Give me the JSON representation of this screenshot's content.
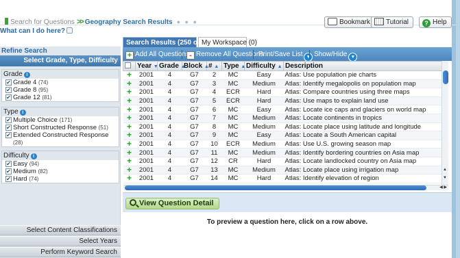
{
  "breadcrumb": {
    "link": "Search for Questions",
    "separator": ">>",
    "current": "Geography Search Results",
    "dots": "● ● ●"
  },
  "what_can": "What can I do here?",
  "header_buttons": {
    "bookmark": "Bookmark",
    "tutorial": "Tutorial",
    "help": "Help"
  },
  "refine": {
    "title": "Refine Search",
    "subtitle": "Select Grade, Type, Difficulty",
    "groups": [
      {
        "label": "Grade",
        "options": [
          {
            "label": "Grade 4",
            "count": "(74)",
            "checked": "✔"
          },
          {
            "label": "Grade 8",
            "count": "(95)",
            "checked": "✔"
          },
          {
            "label": "Grade 12",
            "count": "(81)",
            "checked": "✔"
          }
        ]
      },
      {
        "label": "Type",
        "options": [
          {
            "label": "Multiple Choice",
            "count": "(171)",
            "checked": "✔"
          },
          {
            "label": "Short Constructed Response",
            "count": "(51)",
            "checked": "✔"
          },
          {
            "label": "Extended Constructed Response",
            "count": "(28)",
            "checked": "✔"
          }
        ]
      },
      {
        "label": "Difficulty",
        "options": [
          {
            "label": "Easy",
            "count": "(94)",
            "checked": "✔"
          },
          {
            "label": "Medium",
            "count": "(82)",
            "checked": "✔"
          },
          {
            "label": "Hard",
            "count": "(74)",
            "checked": "✔"
          }
        ]
      }
    ],
    "bottom_buttons": [
      "Select Content Classifications",
      "Select Years",
      "Perform Keyword Search"
    ]
  },
  "tabs": {
    "results": "Search Results (250 of 250)",
    "workspace": "My Workspace (0)"
  },
  "toolbar": {
    "add_all": "Add All Questions",
    "remove_all": "Remove All Questions",
    "print_save": "Print/Save List",
    "show_hide": "Show/Hide"
  },
  "table": {
    "headers": [
      "Year",
      "Grade",
      "Block",
      "#",
      "Type",
      "Difficulty",
      "Description"
    ],
    "rows": [
      [
        "2001",
        "4",
        "G7",
        "2",
        "MC",
        "Easy",
        "Atlas: Use population pie charts"
      ],
      [
        "2001",
        "4",
        "G7",
        "3",
        "MC",
        "Medium",
        "Atlas: Identify megalopolis on population map"
      ],
      [
        "2001",
        "4",
        "G7",
        "4",
        "ECR",
        "Hard",
        "Atlas: Compare countries using three maps"
      ],
      [
        "2001",
        "4",
        "G7",
        "5",
        "ECR",
        "Hard",
        "Atlas: Use maps to explain land use"
      ],
      [
        "2001",
        "4",
        "G7",
        "6",
        "MC",
        "Easy",
        "Atlas: Locate ice caps and glaciers on world map"
      ],
      [
        "2001",
        "4",
        "G7",
        "7",
        "MC",
        "Medium",
        "Atlas: Locate continents in tropics"
      ],
      [
        "2001",
        "4",
        "G7",
        "8",
        "MC",
        "Medium",
        "Atlas: Locate place using latitude and longitude"
      ],
      [
        "2001",
        "4",
        "G7",
        "9",
        "MC",
        "Easy",
        "Atlas: Locate a South American capital"
      ],
      [
        "2001",
        "4",
        "G7",
        "10",
        "ECR",
        "Medium",
        "Atlas: Use U.S. growing season map"
      ],
      [
        "2001",
        "4",
        "G7",
        "11",
        "MC",
        "Medium",
        "Atlas: Identify bordering countries on Asia map"
      ],
      [
        "2001",
        "4",
        "G7",
        "12",
        "CR",
        "Hard",
        "Atlas: Locate landlocked country on Asia map"
      ],
      [
        "2001",
        "4",
        "G7",
        "13",
        "MC",
        "Medium",
        "Atlas: Locate place using irrigation map"
      ],
      [
        "2001",
        "4",
        "G7",
        "14",
        "MC",
        "Hard",
        "Atlas: Identify elevation of region"
      ]
    ]
  },
  "detail": {
    "view_button": "View Question Detail",
    "preview_text": "To preview a question here, click on a row above."
  }
}
